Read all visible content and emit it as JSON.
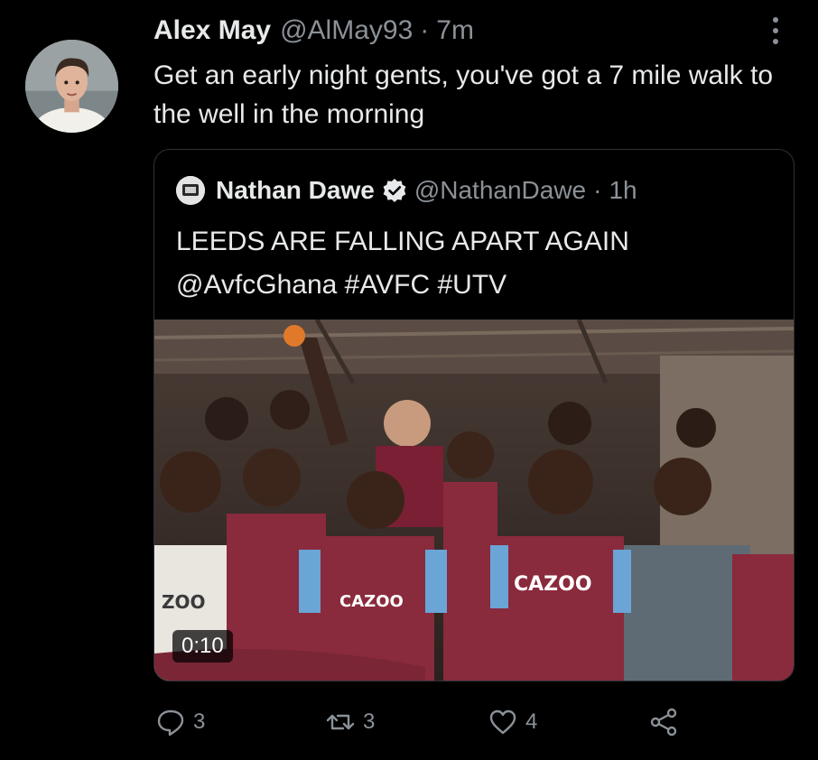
{
  "tweet": {
    "display_name": "Alex May",
    "handle": "@AlMay93",
    "separator": "·",
    "time": "7m",
    "text": "Get an early night gents, you've got a 7 mile walk to the well in the morning",
    "avatar_icon": "profile-photo"
  },
  "quote": {
    "display_name": "Nathan Dawe",
    "verified": true,
    "handle": "@NathanDawe",
    "separator": "·",
    "time": "1h",
    "text_line1": "LEEDS ARE FALLING APART AGAIN",
    "text_line2": "@AvfcGhana #AVFC #UTV",
    "media": {
      "type": "video",
      "duration": "0:10",
      "shirt_text": "CAZOO",
      "shirt_text_partial": "ZOO"
    }
  },
  "actions": {
    "reply_count": "3",
    "retweet_count": "3",
    "like_count": "4"
  },
  "colors": {
    "background": "#000000",
    "primary_text": "#e7e9ea",
    "secondary_text": "#8b9197",
    "border": "#2f3336",
    "shirt_claret": "#8a2a3d",
    "shirt_blue": "#6aa5d6"
  }
}
